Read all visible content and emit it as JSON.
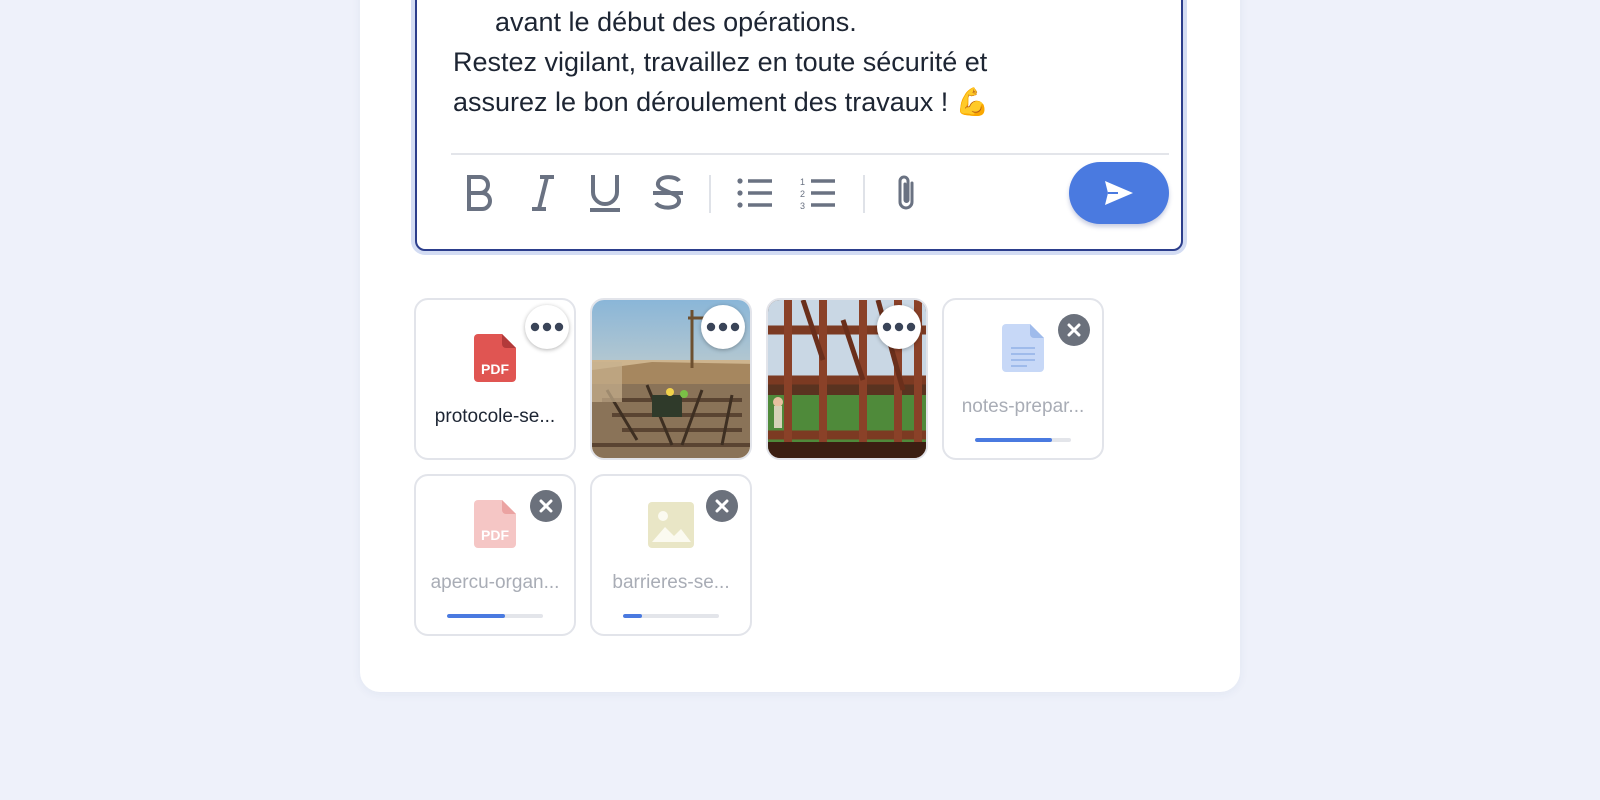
{
  "composer": {
    "lines": [
      {
        "text": "avant le début des opérations.",
        "indent": true
      },
      {
        "text": "Restez vigilant, travaillez en toute sécurité et",
        "indent": false
      },
      {
        "text": "assurez le bon déroulement des travaux ! 💪",
        "indent": false
      }
    ]
  },
  "toolbar": {
    "buttons": [
      "bold-icon",
      "italic-icon",
      "underline-icon",
      "strikethrough-icon",
      "bulleted-list-icon",
      "numbered-list-icon",
      "paperclip-icon"
    ],
    "send_icon": "send-icon",
    "accent": "#4a7ae0"
  },
  "attachments": [
    {
      "name": "protocole-se...",
      "kind": "pdf",
      "status": "uploaded",
      "action": "more-icon"
    },
    {
      "name": "",
      "kind": "photo-construction-site",
      "status": "uploaded",
      "action": "more-icon"
    },
    {
      "name": "",
      "kind": "photo-steel-frame",
      "status": "uploaded",
      "action": "more-icon"
    },
    {
      "name": "notes-prepar...",
      "kind": "document",
      "status": "uploading",
      "progress": 0.8,
      "action": "close-icon"
    },
    {
      "name": "apercu-organ...",
      "kind": "pdf",
      "status": "uploading",
      "progress": 0.6,
      "action": "close-icon"
    },
    {
      "name": "barrieres-se...",
      "kind": "image",
      "status": "uploading",
      "progress": 0.2,
      "action": "close-icon"
    }
  ],
  "pdf_label": "PDF"
}
